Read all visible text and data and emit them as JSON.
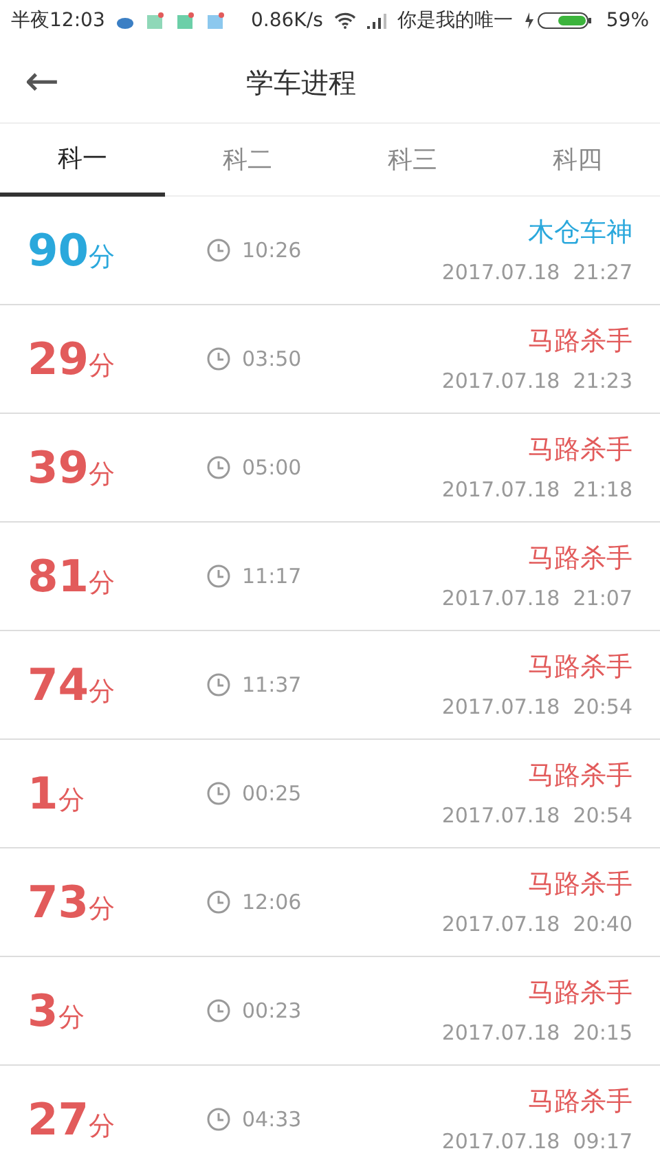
{
  "status_bar": {
    "time": "半夜12:03",
    "speed": "0.86K/s",
    "carrier": "你是我的唯一",
    "battery": "59%"
  },
  "header": {
    "back": "←",
    "title": "学车进程"
  },
  "tabs": [
    {
      "label": "科一",
      "selected": true
    },
    {
      "label": "科二",
      "selected": false
    },
    {
      "label": "科三",
      "selected": false
    },
    {
      "label": "科四",
      "selected": false
    }
  ],
  "records": [
    {
      "score": "90",
      "unit": "分",
      "duration": "10:26",
      "rank": "木仓车神",
      "datetime": "2017.07.18  21:27",
      "color": "#2aa8dc"
    },
    {
      "score": "29",
      "unit": "分",
      "duration": "03:50",
      "rank": "马路杀手",
      "datetime": "2017.07.18  21:23",
      "color": "#e25b5b"
    },
    {
      "score": "39",
      "unit": "分",
      "duration": "05:00",
      "rank": "马路杀手",
      "datetime": "2017.07.18  21:18",
      "color": "#e25b5b"
    },
    {
      "score": "81",
      "unit": "分",
      "duration": "11:17",
      "rank": "马路杀手",
      "datetime": "2017.07.18  21:07",
      "color": "#e25b5b"
    },
    {
      "score": "74",
      "unit": "分",
      "duration": "11:37",
      "rank": "马路杀手",
      "datetime": "2017.07.18  20:54",
      "color": "#e25b5b"
    },
    {
      "score": "1",
      "unit": "分",
      "duration": "00:25",
      "rank": "马路杀手",
      "datetime": "2017.07.18  20:54",
      "color": "#e25b5b"
    },
    {
      "score": "73",
      "unit": "分",
      "duration": "12:06",
      "rank": "马路杀手",
      "datetime": "2017.07.18  20:40",
      "color": "#e25b5b"
    },
    {
      "score": "3",
      "unit": "分",
      "duration": "00:23",
      "rank": "马路杀手",
      "datetime": "2017.07.18  20:15",
      "color": "#e25b5b"
    },
    {
      "score": "27",
      "unit": "分",
      "duration": "04:33",
      "rank": "马路杀手",
      "datetime": "2017.07.18  09:17",
      "color": "#e25b5b"
    }
  ]
}
